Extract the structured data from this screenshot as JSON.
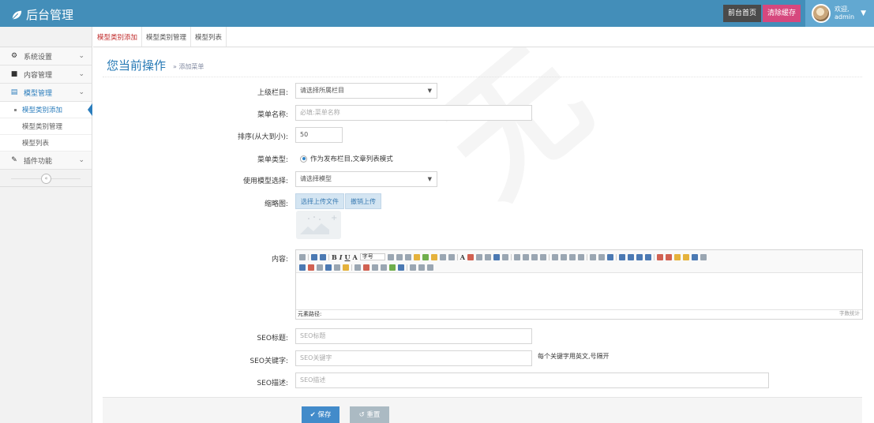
{
  "app": {
    "title": "后台管理"
  },
  "header": {
    "home_label": "前台首页",
    "clear_cache_label": "清除缓存",
    "user_greeting": "欢迎,",
    "user_name": "admin"
  },
  "sidebar": {
    "items": [
      {
        "label": "系统设置",
        "icon": "gears-icon"
      },
      {
        "label": "内容管理",
        "icon": "folder-icon"
      },
      {
        "label": "模型管理",
        "icon": "list-icon"
      },
      {
        "label": "插件功能",
        "icon": "wrench-icon"
      }
    ],
    "sub_items": [
      {
        "label": "模型类别添加"
      },
      {
        "label": "模型类别管理"
      },
      {
        "label": "模型列表"
      }
    ],
    "collapse_icon": "double-chevron-left-icon"
  },
  "tabs": [
    {
      "label": "模型类别添加"
    },
    {
      "label": "模型类别管理"
    },
    {
      "label": "模型列表"
    }
  ],
  "page": {
    "title": "您当前操作",
    "subtitle": "» 添加菜单"
  },
  "form": {
    "parent_label": "上级栏目:",
    "parent_value": "请选择所属栏目",
    "name_label": "菜单名称:",
    "name_placeholder": "必填:菜单名称",
    "order_label": "排序(从大到小):",
    "order_value": "50",
    "type_label": "菜单类型:",
    "type_option": "作为发布栏目,文章列表模式",
    "model_label": "使用模型选择:",
    "model_value": "请选择模型",
    "thumb_label": "缩略图:",
    "upload_label": "选择上传文件",
    "cancel_upload_label": "撤销上传",
    "content_label": "内容:",
    "editor_font_value": "字号",
    "editor_path_label": "元素路径:",
    "editor_count_label": "字数统计",
    "seo_title_label": "SEO标题:",
    "seo_title_placeholder": "SEO标题",
    "seo_keywords_label": "SEO关键字:",
    "seo_keywords_placeholder": "SEO关键字",
    "seo_keywords_help": "每个关键字用英文,号隔开",
    "seo_desc_label": "SEO描述:",
    "seo_desc_placeholder": "SEO描述"
  },
  "actions": {
    "save_label": "✔ 保存",
    "reset_label": "↺ 重置"
  }
}
